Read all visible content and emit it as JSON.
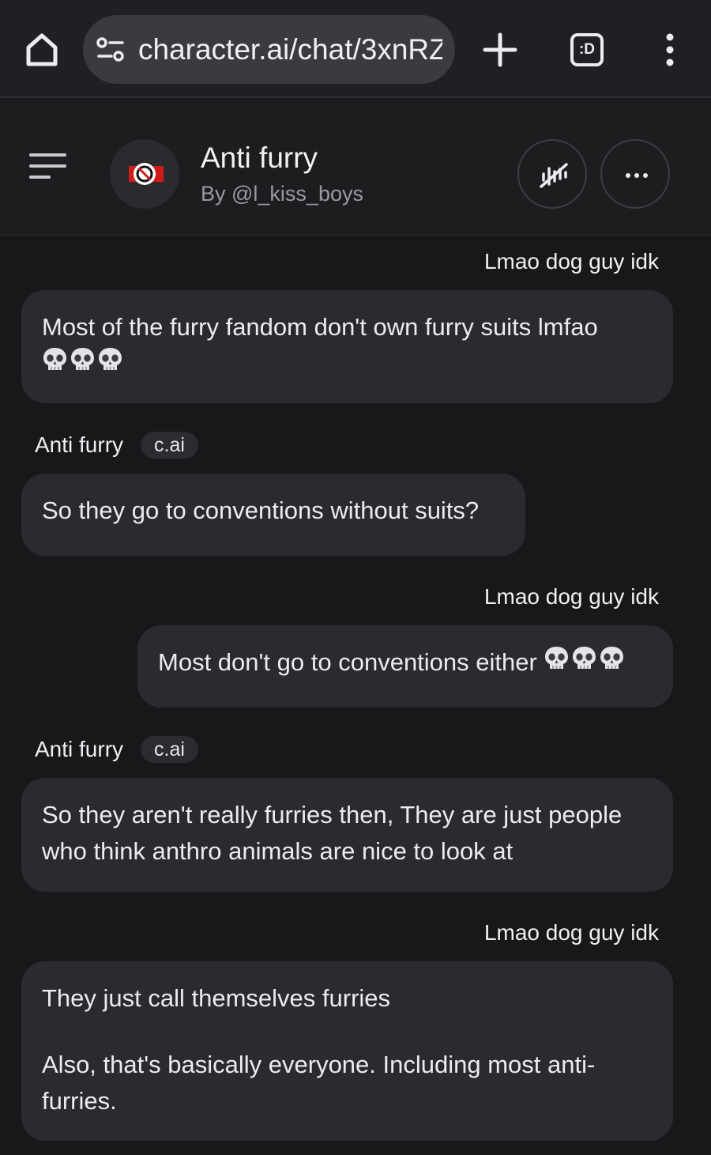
{
  "browser": {
    "url": "character.ai/chat/3xnRZ",
    "tabs_label": ":D",
    "icons": [
      "home-icon",
      "site-settings-icon",
      "plus-icon",
      "tabs-icon",
      "overflow-menu-icon"
    ]
  },
  "header": {
    "character_name": "Anti furry",
    "creator": "By @l_kiss_boys",
    "icons": [
      "menu-icon",
      "avatar",
      "voice-off-icon",
      "more-icon"
    ]
  },
  "messages": [
    {
      "side": "user",
      "author": "Lmao dog guy idk",
      "text": "Most of the furry fandom don't own furry suits lmfao",
      "emoji": "💀💀💀"
    },
    {
      "side": "character",
      "author": "Anti furry",
      "badge": "c.ai",
      "text": "So they go to conventions without suits?"
    },
    {
      "side": "user",
      "author": "Lmao dog guy idk",
      "text": "Most don't go to conventions either",
      "emoji": "💀💀💀"
    },
    {
      "side": "character",
      "author": "Anti furry",
      "badge": "c.ai",
      "text_line1": "So they aren't really furries then, They are just people",
      "text_line2": "who think anthro animals are nice to look at"
    },
    {
      "side": "user",
      "author": "Lmao dog guy idk",
      "paragraph1": "They just call themselves furries",
      "paragraph2_line1": "Also, that's basically everyone. Including most anti-",
      "paragraph2_line2": "furries."
    }
  ],
  "colors": {
    "background": "#18181b",
    "bubble": "#2a2b2f",
    "browser_bar": "#1f2023",
    "url_pill": "#3a3b3f",
    "text": "#ececf0",
    "muted_text": "#9a9aa3"
  }
}
